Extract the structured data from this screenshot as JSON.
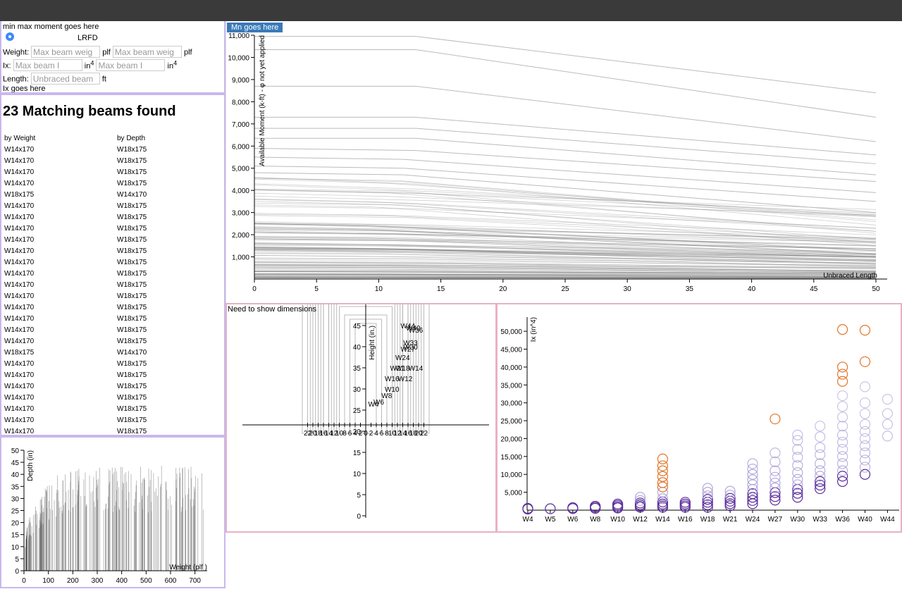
{
  "filters": {
    "min_max_text": "min max moment goes here",
    "design_method": "LRFD",
    "weight_label": "Weight:",
    "weight_min_placeholder": "Max beam weig",
    "weight_max_placeholder": "Max beam weig",
    "weight_unit": "plf",
    "ix_label": "Ix:",
    "ix_min_placeholder": "Max beam I",
    "ix_max_placeholder": "Max beam I",
    "ix_unit": "in",
    "ix_unit_sup": "4",
    "length_label": "Length:",
    "length_placeholder": "Unbraced beam",
    "length_unit": "ft",
    "ix_goes_here": "Ix goes here"
  },
  "results": {
    "title": "23 Matching beams found",
    "col_weight": "by Weight",
    "col_depth": "by Depth",
    "rows": [
      [
        "W14x170",
        "W18x175"
      ],
      [
        "W14x170",
        "W18x175"
      ],
      [
        "W14x170",
        "W18x175"
      ],
      [
        "W14x170",
        "W18x175"
      ],
      [
        "W18x175",
        "W14x170"
      ],
      [
        "W14x170",
        "W18x175"
      ],
      [
        "W14x170",
        "W18x175"
      ],
      [
        "W14x170",
        "W18x175"
      ],
      [
        "W14x170",
        "W18x175"
      ],
      [
        "W14x170",
        "W18x175"
      ],
      [
        "W14x170",
        "W18x175"
      ],
      [
        "W14x170",
        "W18x175"
      ],
      [
        "W14x170",
        "W18x175"
      ],
      [
        "W14x170",
        "W18x175"
      ],
      [
        "W14x170",
        "W18x175"
      ],
      [
        "W14x170",
        "W18x175"
      ],
      [
        "W14x170",
        "W18x175"
      ],
      [
        "W14x170",
        "W18x175"
      ],
      [
        "W18x175",
        "W14x170"
      ],
      [
        "W14x170",
        "W18x175"
      ],
      [
        "W14x170",
        "W18x175"
      ],
      [
        "W14x170",
        "W18x175"
      ],
      [
        "W14x170",
        "W18x175"
      ],
      [
        "W14x170",
        "W18x175"
      ],
      [
        "W14x170",
        "W18x175"
      ],
      [
        "W14x170",
        "W18x175"
      ]
    ]
  },
  "moment_button": "Mn goes here",
  "need_dims_text": "Need to show dimensions",
  "chart_data": [
    {
      "type": "line",
      "title": "",
      "xlabel": "Unbraced Length",
      "ylabel": "Available Moment (k-ft) - φ not yet applied",
      "xlim": [
        0,
        50
      ],
      "ylim": [
        0,
        11000
      ],
      "x_ticks": [
        0,
        5,
        10,
        15,
        20,
        25,
        30,
        35,
        40,
        45,
        50
      ],
      "y_ticks": [
        1000,
        2000,
        3000,
        4000,
        5000,
        6000,
        7000,
        8000,
        9000,
        10000,
        11000
      ],
      "y_tick_labels": [
        "1,000",
        "2,000",
        "3,000",
        "4,000",
        "5,000",
        "6,000",
        "7,000",
        "8,000",
        "9,000",
        "10,000",
        "11,000"
      ],
      "highlighted_series": [
        {
          "values_at_x": [
            [
              0,
              10950
            ],
            [
              13,
              10950
            ],
            [
              50,
              8400
            ]
          ]
        },
        {
          "values_at_x": [
            [
              0,
              10350
            ],
            [
              13,
              10350
            ],
            [
              50,
              7300
            ]
          ]
        },
        {
          "values_at_x": [
            [
              0,
              8700
            ],
            [
              13,
              8700
            ],
            [
              50,
              6200
            ]
          ]
        },
        {
          "values_at_x": [
            [
              0,
              7300
            ],
            [
              13,
              7300
            ],
            [
              50,
              5600
            ]
          ]
        },
        {
          "values_at_x": [
            [
              0,
              6800
            ],
            [
              13,
              6800
            ],
            [
              50,
              5200
            ]
          ]
        },
        {
          "values_at_x": [
            [
              0,
              6350
            ],
            [
              13,
              6350
            ],
            [
              50,
              4700
            ]
          ]
        },
        {
          "values_at_x": [
            [
              0,
              5900
            ],
            [
              13,
              5800
            ],
            [
              50,
              4400
            ]
          ]
        },
        {
          "values_at_x": [
            [
              0,
              5500
            ],
            [
              12,
              5400
            ],
            [
              50,
              3900
            ]
          ]
        },
        {
          "values_at_x": [
            [
              0,
              5100
            ],
            [
              12,
              5000
            ],
            [
              50,
              3500
            ]
          ]
        },
        {
          "values_at_x": [
            [
              0,
              4800
            ],
            [
              12,
              4700
            ],
            [
              50,
              3000
            ]
          ]
        }
      ],
      "background_series_count": 120
    },
    {
      "type": "scatter",
      "title": "",
      "xlabel": "",
      "ylabel": "Height (in.)",
      "x_ticks": [
        22,
        20,
        18,
        16,
        14,
        12,
        10,
        8,
        6,
        4,
        2,
        0,
        2,
        4,
        6,
        8,
        10,
        12,
        14,
        16,
        18,
        20,
        22
      ],
      "y_ticks": [
        0,
        5,
        10,
        15,
        20,
        25,
        30,
        35,
        40,
        45
      ],
      "labels": [
        {
          "name": "W44",
          "x": 8.5,
          "y": 45
        },
        {
          "name": "W40",
          "x": 9.5,
          "y": 44.5
        },
        {
          "name": "W36",
          "x": 10,
          "y": 44
        },
        {
          "name": "W33",
          "x": 9,
          "y": 41
        },
        {
          "name": "W30",
          "x": 9,
          "y": 40
        },
        {
          "name": "W27",
          "x": 8.5,
          "y": 39.5
        },
        {
          "name": "W24",
          "x": 7.5,
          "y": 37.5
        },
        {
          "name": "W21",
          "x": 6.5,
          "y": 35
        },
        {
          "name": "W18",
          "x": 7.5,
          "y": 35
        },
        {
          "name": "W14",
          "x": 10,
          "y": 35
        },
        {
          "name": "W16",
          "x": 5.5,
          "y": 32.5
        },
        {
          "name": "W12",
          "x": 8,
          "y": 32.5
        },
        {
          "name": "W10",
          "x": 5.5,
          "y": 30
        },
        {
          "name": "W8",
          "x": 4.5,
          "y": 28.5
        },
        {
          "name": "W6",
          "x": 3,
          "y": 27
        },
        {
          "name": "W4",
          "x": 2,
          "y": 26.5
        }
      ]
    },
    {
      "type": "scatter",
      "title": "",
      "xlabel": "",
      "ylabel": "Ix (in^4)",
      "categories": [
        "W4",
        "W5",
        "W6",
        "W8",
        "W10",
        "W12",
        "W14",
        "W16",
        "W18",
        "W21",
        "W24",
        "W27",
        "W30",
        "W33",
        "W36",
        "W40",
        "W44"
      ],
      "y_ticks": [
        5000,
        10000,
        15000,
        20000,
        25000,
        30000,
        35000,
        40000,
        45000,
        50000
      ],
      "y_tick_labels": [
        "5,000",
        "10,000",
        "15,000",
        "20,000",
        "25,000",
        "30,000",
        "35,000",
        "40,000",
        "45,000",
        "50,000"
      ],
      "ylim": [
        0,
        52000
      ],
      "points": {
        "W4": [
          [
            300,
            "dark"
          ],
          [
            500,
            "dark"
          ]
        ],
        "W5": [
          [
            400,
            "dark"
          ]
        ],
        "W6": [
          [
            450,
            "dark"
          ],
          [
            700,
            "dark"
          ]
        ],
        "W8": [
          [
            500,
            "dark"
          ],
          [
            800,
            "dark"
          ],
          [
            1100,
            "dark"
          ]
        ],
        "W10": [
          [
            600,
            "dark"
          ],
          [
            900,
            "dark"
          ],
          [
            1300,
            "dark"
          ],
          [
            1700,
            "dark"
          ]
        ],
        "W12": [
          [
            800,
            "dark"
          ],
          [
            1100,
            "dark"
          ],
          [
            1500,
            "dark"
          ],
          [
            2000,
            "dark"
          ],
          [
            2700,
            "light"
          ],
          [
            3600,
            "light"
          ]
        ],
        "W14": [
          [
            800,
            "dark"
          ],
          [
            1200,
            "dark"
          ],
          [
            1700,
            "dark"
          ],
          [
            2300,
            "dark"
          ],
          [
            3200,
            "light"
          ],
          [
            5000,
            "light"
          ],
          [
            6500,
            "orange"
          ],
          [
            7700,
            "orange"
          ],
          [
            9400,
            "orange"
          ],
          [
            11000,
            "orange"
          ],
          [
            12400,
            "orange"
          ],
          [
            14300,
            "orange"
          ]
        ],
        "W16": [
          [
            800,
            "dark"
          ],
          [
            1200,
            "dark"
          ],
          [
            1700,
            "dark"
          ],
          [
            2200,
            "dark"
          ]
        ],
        "W18": [
          [
            800,
            "dark"
          ],
          [
            1500,
            "dark"
          ],
          [
            2200,
            "dark"
          ],
          [
            3000,
            "dark"
          ],
          [
            4000,
            "light"
          ],
          [
            5000,
            "light"
          ],
          [
            6100,
            "light"
          ]
        ],
        "W21": [
          [
            1200,
            "dark"
          ],
          [
            1800,
            "dark"
          ],
          [
            2500,
            "dark"
          ],
          [
            3300,
            "dark"
          ],
          [
            4200,
            "light"
          ],
          [
            5300,
            "light"
          ]
        ],
        "W24": [
          [
            1800,
            "dark"
          ],
          [
            2700,
            "dark"
          ],
          [
            3600,
            "dark"
          ],
          [
            4600,
            "dark"
          ],
          [
            5800,
            "light"
          ],
          [
            7100,
            "light"
          ],
          [
            8500,
            "light"
          ],
          [
            10000,
            "light"
          ],
          [
            11500,
            "light"
          ],
          [
            13000,
            "light"
          ]
        ],
        "W27": [
          [
            2800,
            "dark"
          ],
          [
            3800,
            "dark"
          ],
          [
            4900,
            "dark"
          ],
          [
            6200,
            "light"
          ],
          [
            7600,
            "light"
          ],
          [
            9200,
            "light"
          ],
          [
            11000,
            "light"
          ],
          [
            13500,
            "light"
          ],
          [
            16000,
            "light"
          ],
          [
            25500,
            "orange"
          ]
        ],
        "W30": [
          [
            3600,
            "dark"
          ],
          [
            4700,
            "dark"
          ],
          [
            5800,
            "dark"
          ],
          [
            7100,
            "light"
          ],
          [
            8600,
            "light"
          ],
          [
            10500,
            "light"
          ],
          [
            12500,
            "light"
          ],
          [
            14800,
            "light"
          ],
          [
            17000,
            "light"
          ],
          [
            19500,
            "light"
          ],
          [
            21000,
            "light"
          ]
        ],
        "W33": [
          [
            6000,
            "dark"
          ],
          [
            7000,
            "dark"
          ],
          [
            8000,
            "dark"
          ],
          [
            9500,
            "light"
          ],
          [
            11000,
            "light"
          ],
          [
            13000,
            "light"
          ],
          [
            15500,
            "light"
          ],
          [
            17500,
            "light"
          ],
          [
            20500,
            "light"
          ],
          [
            23500,
            "light"
          ]
        ],
        "W36": [
          [
            8000,
            "dark"
          ],
          [
            9500,
            "dark"
          ],
          [
            11000,
            "light"
          ],
          [
            13000,
            "light"
          ],
          [
            15000,
            "light"
          ],
          [
            17000,
            "light"
          ],
          [
            19000,
            "light"
          ],
          [
            21000,
            "light"
          ],
          [
            23500,
            "light"
          ],
          [
            26000,
            "light"
          ],
          [
            29000,
            "light"
          ],
          [
            32000,
            "light"
          ],
          [
            36000,
            "orange"
          ],
          [
            38000,
            "orange"
          ],
          [
            40000,
            "orange"
          ],
          [
            50500,
            "orange"
          ]
        ],
        "W40": [
          [
            10000,
            "dark"
          ],
          [
            12000,
            "light"
          ],
          [
            14000,
            "light"
          ],
          [
            16000,
            "light"
          ],
          [
            18000,
            "light"
          ],
          [
            20000,
            "light"
          ],
          [
            22000,
            "light"
          ],
          [
            24000,
            "light"
          ],
          [
            27000,
            "light"
          ],
          [
            30000,
            "light"
          ],
          [
            34500,
            "light"
          ],
          [
            41500,
            "orange"
          ],
          [
            50300,
            "orange"
          ]
        ],
        "W44": [
          [
            20700,
            "light"
          ],
          [
            24000,
            "light"
          ],
          [
            27000,
            "light"
          ],
          [
            31000,
            "light"
          ]
        ]
      }
    },
    {
      "type": "bar",
      "title": "",
      "xlabel": "Weight (plf )",
      "ylabel": "Depth (in)",
      "xlim": [
        0,
        750
      ],
      "ylim": [
        0,
        50
      ],
      "x_ticks": [
        0,
        100,
        200,
        300,
        400,
        500,
        600,
        700
      ],
      "y_ticks": [
        0,
        5,
        10,
        15,
        20,
        25,
        30,
        35,
        40,
        45,
        50
      ]
    }
  ],
  "colors": {
    "panel_border_lavender": "#c9b8ee",
    "panel_border_pink": "#eab0c4",
    "button_blue": "#3b7ab8",
    "dark_purple": "#5b2d9c",
    "light_purple": "#a79bd6",
    "orange": "#e0762a"
  }
}
